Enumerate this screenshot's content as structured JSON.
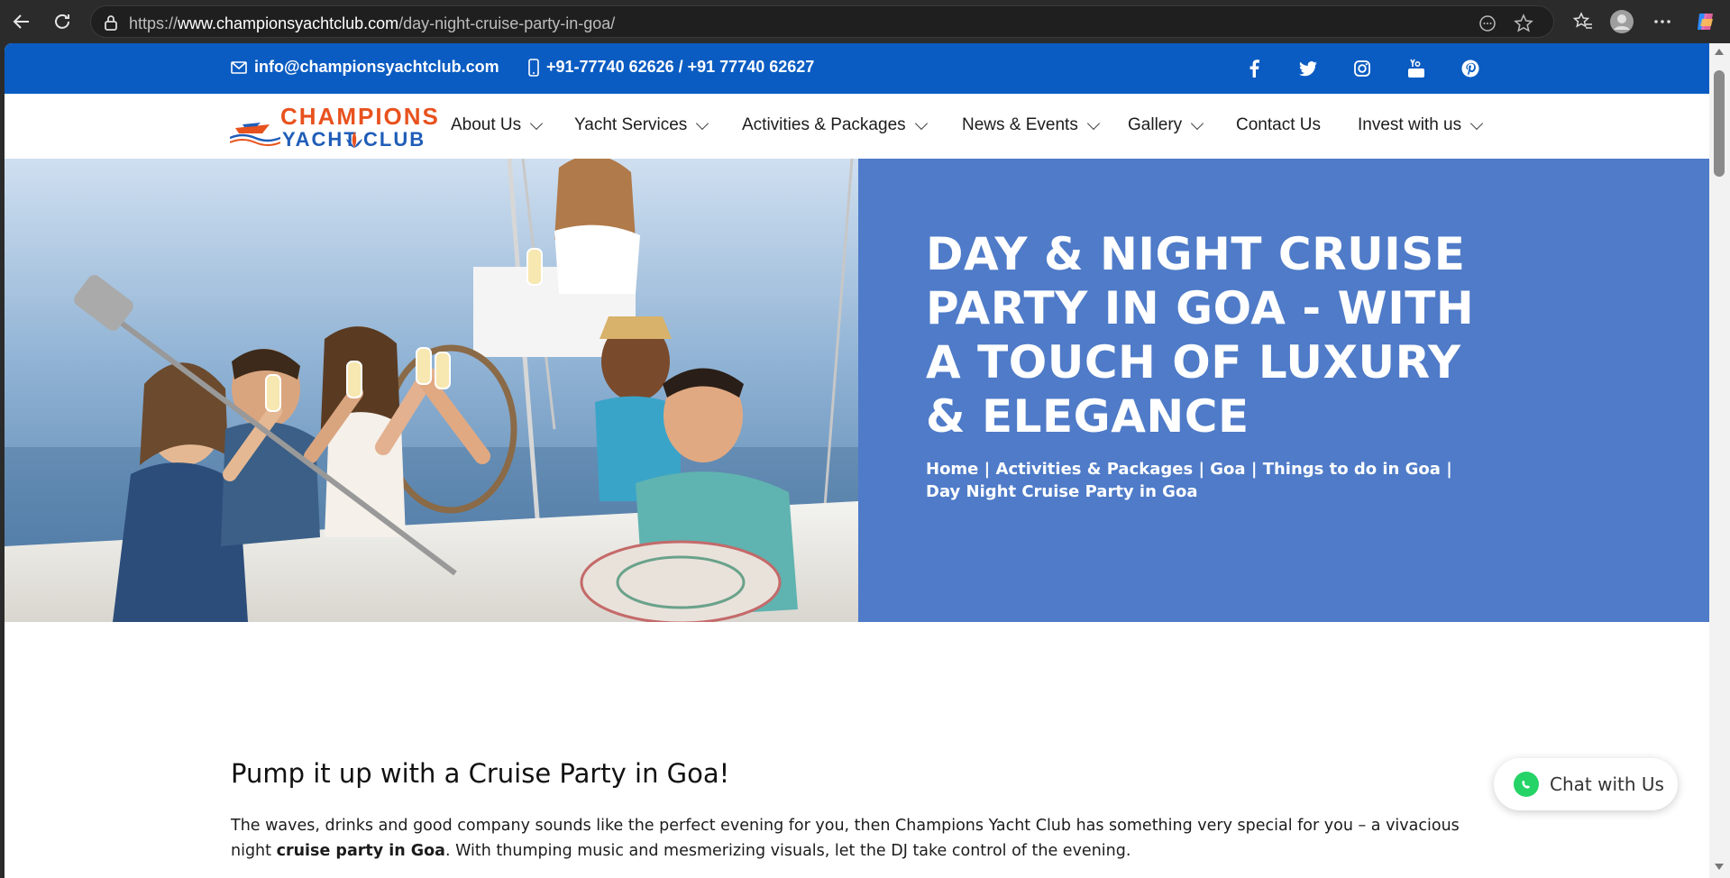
{
  "browser": {
    "url_prefix": "https://",
    "url_domain": "www.championsyachtclub.com",
    "url_path": "/day-night-cruise-party-in-goa/"
  },
  "topbar": {
    "email": "info@championsyachtclub.com",
    "phone": "+91-77740 62626 / +91 77740 62627",
    "bg_color": "#0a5cc2"
  },
  "logo": {
    "line1": "CHAMPIONS",
    "line2a": "YACHT",
    "line2b": "CLUB"
  },
  "nav": {
    "items": [
      {
        "label": "About Us"
      },
      {
        "label": "Yacht Services"
      },
      {
        "label": "Activities & Packages"
      },
      {
        "label": "News & Events"
      },
      {
        "label": "Gallery"
      },
      {
        "label": "Contact Us"
      },
      {
        "label": "Invest with us"
      }
    ]
  },
  "hero": {
    "title": "DAY & NIGHT CRUISE PARTY IN GOA - WITH A TOUCH OF LUXURY & ELEGANCE",
    "crumbs": [
      "Home",
      "Activities & Packages",
      "Goa",
      "Things to do in Goa",
      "Day Night Cruise Party in Goa"
    ],
    "panel_color": "#4f7bc8"
  },
  "content": {
    "heading": "Pump it up with a Cruise Party in Goa!",
    "para_start": "The waves, drinks and good company sounds like the perfect evening for you, then Champions Yacht Club has something very special for you – a vivacious night ",
    "para_bold": "cruise party in Goa",
    "para_end": ". With thumping music and mesmerizing visuals, let the DJ take control of the evening."
  },
  "chat": {
    "label": "Chat with Us"
  }
}
